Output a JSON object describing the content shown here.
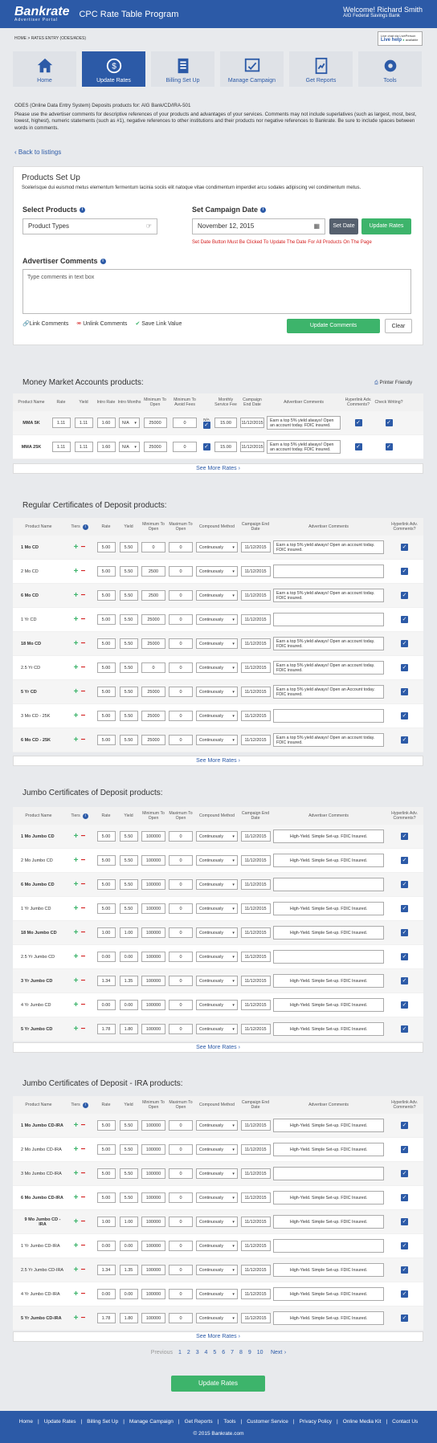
{
  "header": {
    "logo": "Bankrate",
    "logo_sub": "Advertiser Portal",
    "program_title": "CPC Rate Table Program",
    "welcome": "Welcome! Richard Smith",
    "bank": "AIG Federal Savings Bank"
  },
  "breadcrumb": "HOME  >  RATES ENTRY (ODES/ADES)",
  "livehelp": {
    "top": "Live chat via LivePerson",
    "label": "Live help",
    "status": "available"
  },
  "nav": [
    {
      "label": "Home"
    },
    {
      "label": "Update Rates"
    },
    {
      "label": "Billing Set Up"
    },
    {
      "label": "Manage Campaign"
    },
    {
      "label": "Get Reports"
    },
    {
      "label": "Tools"
    }
  ],
  "intro": {
    "line1": "ODES (Online Data Entry System) Deposits products for: AIG Bank/CD/IRA-501",
    "line2": "Please use the advertiser comments for descriptive references of your products and advantages of your services. Comments may not include superlatives (such as largest, most, best, lowest, highest), numeric statements (such as #1), negative references to other institutions and their products nor negative references to Bankrate. Be sure to include spaces between words in comments."
  },
  "back": "Back to listings",
  "products_setup": {
    "title": "Products Set Up",
    "desc": "Scelerisque dui euismod metus elementum fermentum lacinia sociis elit natoque vitae condimentum imperdiet arcu sodales adipiscing vel condimentum metus.",
    "select_label": "Select Products",
    "select_value": "Product Types",
    "date_label": "Set Campaign Date",
    "date_value": "November 12, 2015",
    "set_date": "Set Date",
    "update_rates": "Update Rates",
    "warning": "Set Date Button Must Be Clicked To Update The Date For All Products On The Page",
    "comments_label": "Advertiser Comments",
    "comments_placeholder": "Type comments in text box",
    "link_comments": "Link Comments",
    "unlink_comments": "Unlink Comments",
    "save_link": "Save Link Value",
    "update_comments": "Update Comments",
    "clear": "Clear"
  },
  "mm": {
    "title": "Money Market Accounts products:",
    "printer": "Printer Friendly",
    "headers": [
      "Product Name",
      "Rate",
      "Yield",
      "Intro Rate",
      "Intro Months",
      "Minimum To Open",
      "Minimum To Avoid Fees",
      "",
      "Monthly Service Fee",
      "Campaign End Date",
      "Advertiser Comments",
      "Hyperlink Adv. Comments?",
      "Check Writing?"
    ],
    "na": "N/A",
    "rows": [
      {
        "name": "MMA 5K",
        "rate": "1.11",
        "yield": "1.11",
        "intro": "1.60",
        "months": "N/A",
        "min": "25000",
        "fee_min": "0",
        "fee": "15.00",
        "end": "11/12/2015",
        "comment": "Earn a top 5% yield always! Open an account today. FDIC insured."
      },
      {
        "name": "MMA 25K",
        "rate": "1.11",
        "yield": "1.11",
        "intro": "1.60",
        "months": "N/A",
        "min": "25000",
        "fee_min": "0",
        "fee": "15.00",
        "end": "11/12/2015",
        "comment": "Earn a top 5% yield always! Open an account today. FDIC insured."
      }
    ]
  },
  "see_more": "See More Rates",
  "cd_headers": [
    "Product Name",
    "Tiers",
    "Rate",
    "Yield",
    "Minimum To Open",
    "Maximum To Open",
    "Compound Method",
    "Campaign End Date",
    "Advertiser Comments",
    "Hyperlink Adv. Comments?"
  ],
  "compound": "Continuously",
  "sections": [
    {
      "title": "Regular Certificates of Deposit products:",
      "rows": [
        {
          "name": "1 Mo CD",
          "rate": "5.00",
          "yield": "5.50",
          "min": "0",
          "max": "0",
          "end": "11/12/2015",
          "comment": "Earn a top 5% yield always! Open an account today. FDIC insured."
        },
        {
          "name": "2 Mo CD",
          "rate": "5.00",
          "yield": "5.50",
          "min": "2500",
          "max": "0",
          "end": "11/12/2015",
          "comment": ""
        },
        {
          "name": "6 Mo CD",
          "rate": "5.00",
          "yield": "5.50",
          "min": "2500",
          "max": "0",
          "end": "11/12/2015",
          "comment": "Earn a top 5% yield always! Open an account today. FDIC insured."
        },
        {
          "name": "1 Yr CD",
          "rate": "5.00",
          "yield": "5.50",
          "min": "25000",
          "max": "0",
          "end": "11/12/2015",
          "comment": ""
        },
        {
          "name": "18 Mo CD",
          "rate": "5.00",
          "yield": "5.50",
          "min": "25000",
          "max": "0",
          "end": "11/12/2015",
          "comment": "Earn a top 5% yield always! Open an account today. FDIC insured."
        },
        {
          "name": "2.5 Yr CD",
          "rate": "5.00",
          "yield": "5.50",
          "min": "0",
          "max": "0",
          "end": "11/12/2015",
          "comment": "Earn a top 5% yield always! Open an account today. FDIC insured."
        },
        {
          "name": "5 Yr CD",
          "rate": "5.00",
          "yield": "5.50",
          "min": "25000",
          "max": "0",
          "end": "11/12/2015",
          "comment": "Earn a top 5% yield always! Open an Account today. FDIC insured."
        },
        {
          "name": "3 Mo CD - 25K",
          "rate": "5.00",
          "yield": "5.50",
          "min": "25000",
          "max": "0",
          "end": "11/12/2015",
          "comment": ""
        },
        {
          "name": "6 Mo CD - 25K",
          "rate": "5.00",
          "yield": "5.50",
          "min": "25000",
          "max": "0",
          "end": "11/12/2015",
          "comment": "Earn a top 5% yield always! Open an account today. FDIC insured."
        }
      ]
    },
    {
      "title": "Jumbo Certificates of Deposit products:",
      "rows": [
        {
          "name": "1 Mo Jumbo CD",
          "rate": "5.00",
          "yield": "5.50",
          "min": "100000",
          "max": "0",
          "end": "11/12/2015",
          "comment": "High-Yield. Simple Set-up. FDIC Insured."
        },
        {
          "name": "2 Mo Jumbo CD",
          "rate": "5.00",
          "yield": "5.50",
          "min": "100000",
          "max": "0",
          "end": "11/12/2015",
          "comment": "High-Yield. Simple Set-up. FDIC Insured."
        },
        {
          "name": "6 Mo Jumbo CD",
          "rate": "5.00",
          "yield": "5.50",
          "min": "100000",
          "max": "0",
          "end": "11/12/2015",
          "comment": ""
        },
        {
          "name": "1 Yr Jumbo CD",
          "rate": "5.00",
          "yield": "5.50",
          "min": "100000",
          "max": "0",
          "end": "11/12/2015",
          "comment": "High-Yield. Simple Set-up. FDIC Insured."
        },
        {
          "name": "18 Mo Jumbo CD",
          "rate": "1.00",
          "yield": "1.00",
          "min": "100000",
          "max": "0",
          "end": "11/12/2015",
          "comment": "High-Yield. Simple Set-up. FDIC Insured."
        },
        {
          "name": "2.5 Yr Jumbo CD",
          "rate": "0.00",
          "yield": "0.00",
          "min": "100000",
          "max": "0",
          "end": "11/12/2015",
          "comment": ""
        },
        {
          "name": "3 Yr Jumbo CD",
          "rate": "1.34",
          "yield": "1.35",
          "min": "100000",
          "max": "0",
          "end": "11/12/2015",
          "comment": "High-Yield. Simple Set-up. FDIC Insured."
        },
        {
          "name": "4 Yr Jumbo CD",
          "rate": "0.00",
          "yield": "0.00",
          "min": "100000",
          "max": "0",
          "end": "11/12/2015",
          "comment": "High-Yield. Simple Set-up. FDIC Insured."
        },
        {
          "name": "5 Yr Jumbo CD",
          "rate": "1.78",
          "yield": "1.80",
          "min": "100000",
          "max": "0",
          "end": "11/12/2015",
          "comment": "High-Yield. Simple Set-up. FDIC Insured."
        }
      ]
    },
    {
      "title": "Jumbo Certificates of Deposit - IRA products:",
      "rows": [
        {
          "name": "1 Mo Jumbo CD-IRA",
          "rate": "5.00",
          "yield": "5.50",
          "min": "100000",
          "max": "0",
          "end": "11/12/2015",
          "comment": "High-Yield. Simple Set-up. FDIC Insured."
        },
        {
          "name": "2 Mo Jumbo CD-IRA",
          "rate": "5.00",
          "yield": "5.50",
          "min": "100000",
          "max": "0",
          "end": "11/12/2015",
          "comment": "High-Yield. Simple Set-up. FDIC Insured."
        },
        {
          "name": "3 Mo Jumbo CD-IRA",
          "rate": "5.00",
          "yield": "5.50",
          "min": "100000",
          "max": "0",
          "end": "11/12/2015",
          "comment": ""
        },
        {
          "name": "6 Mo Jumbo CD-IRA",
          "rate": "5.00",
          "yield": "5.50",
          "min": "100000",
          "max": "0",
          "end": "11/12/2015",
          "comment": "High-Yield. Simple Set-up. FDIC Insured."
        },
        {
          "name": "9 Mo Jumbo CD - IRA",
          "rate": "1.00",
          "yield": "1.00",
          "min": "100000",
          "max": "0",
          "end": "11/12/2015",
          "comment": "High-Yield. Simple Set-up. FDIC Insured."
        },
        {
          "name": "1 Yr Jumbo CD-IRA",
          "rate": "0.00",
          "yield": "0.00",
          "min": "100000",
          "max": "0",
          "end": "11/12/2015",
          "comment": ""
        },
        {
          "name": "2.5 Yr Jumbo CD-IRA",
          "rate": "1.34",
          "yield": "1.35",
          "min": "100000",
          "max": "0",
          "end": "11/12/2015",
          "comment": "High-Yield. Simple Set-up. FDIC Insured."
        },
        {
          "name": "4 Yr Jumbo CD-IRA",
          "rate": "0.00",
          "yield": "0.00",
          "min": "100000",
          "max": "0",
          "end": "11/12/2015",
          "comment": "High-Yield. Simple Set-up. FDIC Insured."
        },
        {
          "name": "5 Yr Jumbo CD-IRA",
          "rate": "1.78",
          "yield": "1.80",
          "min": "100000",
          "max": "0",
          "end": "11/12/2015",
          "comment": "High-Yield. Simple Set-up. FDIC Insured."
        }
      ]
    }
  ],
  "pager": {
    "prev": "Previous",
    "pages": [
      "1",
      "2",
      "3",
      "4",
      "5",
      "6",
      "7",
      "8",
      "9",
      "10"
    ],
    "next": "Next"
  },
  "bottom_update": "Update Rates",
  "footer": {
    "links": [
      "Home",
      "Update Rates",
      "Billing Set Up",
      "Manage Campaign",
      "Get Reports",
      "Tools",
      "Customer Service",
      "Privacy Policy",
      "Online Media Kit",
      "Contact Us"
    ],
    "copyright": "© 2015 Bankrate.com"
  },
  "colors": {
    "brand": "#2c5aa7",
    "green": "#3db46b",
    "red": "#d42020"
  }
}
